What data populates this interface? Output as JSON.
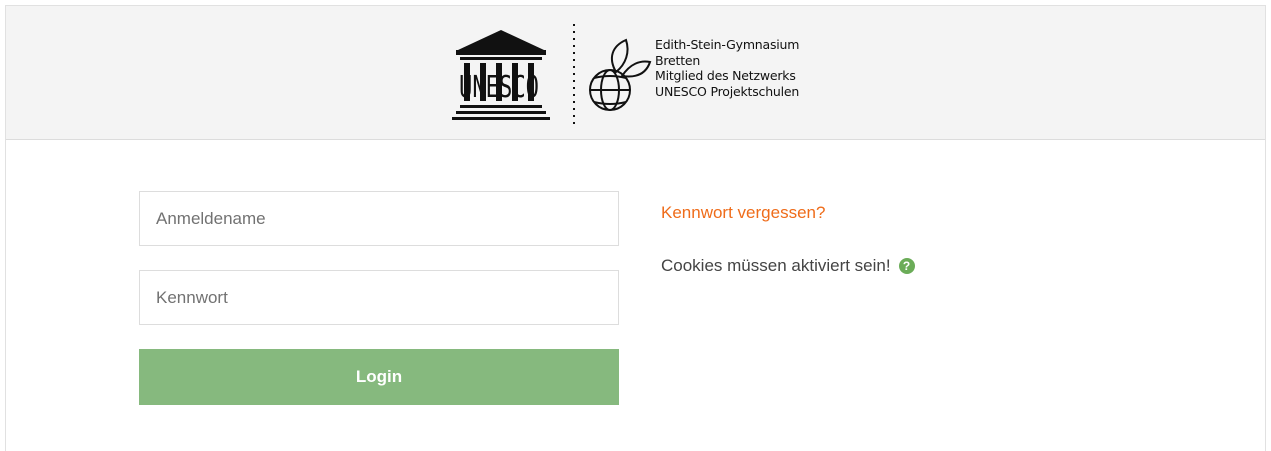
{
  "header": {
    "school_lines": [
      "Edith-Stein-Gymnasium",
      "Bretten",
      "Mitglied des Netzwerks",
      "UNESCO Projektschulen"
    ],
    "unesco_logo_icon": "unesco-temple-logo",
    "school_logo_icon": "globe-leaf-logo"
  },
  "login_form": {
    "username_placeholder": "Anmeldename",
    "username_value": "",
    "password_placeholder": "Kennwort",
    "password_value": "",
    "submit_label": "Login",
    "button_color": "#86b97e"
  },
  "side_info": {
    "forgot_password_link": "Kennwort vergessen?",
    "cookies_notice": "Cookies müssen aktiviert sein!",
    "help_icon": "?",
    "link_color": "#ef6c1a"
  }
}
